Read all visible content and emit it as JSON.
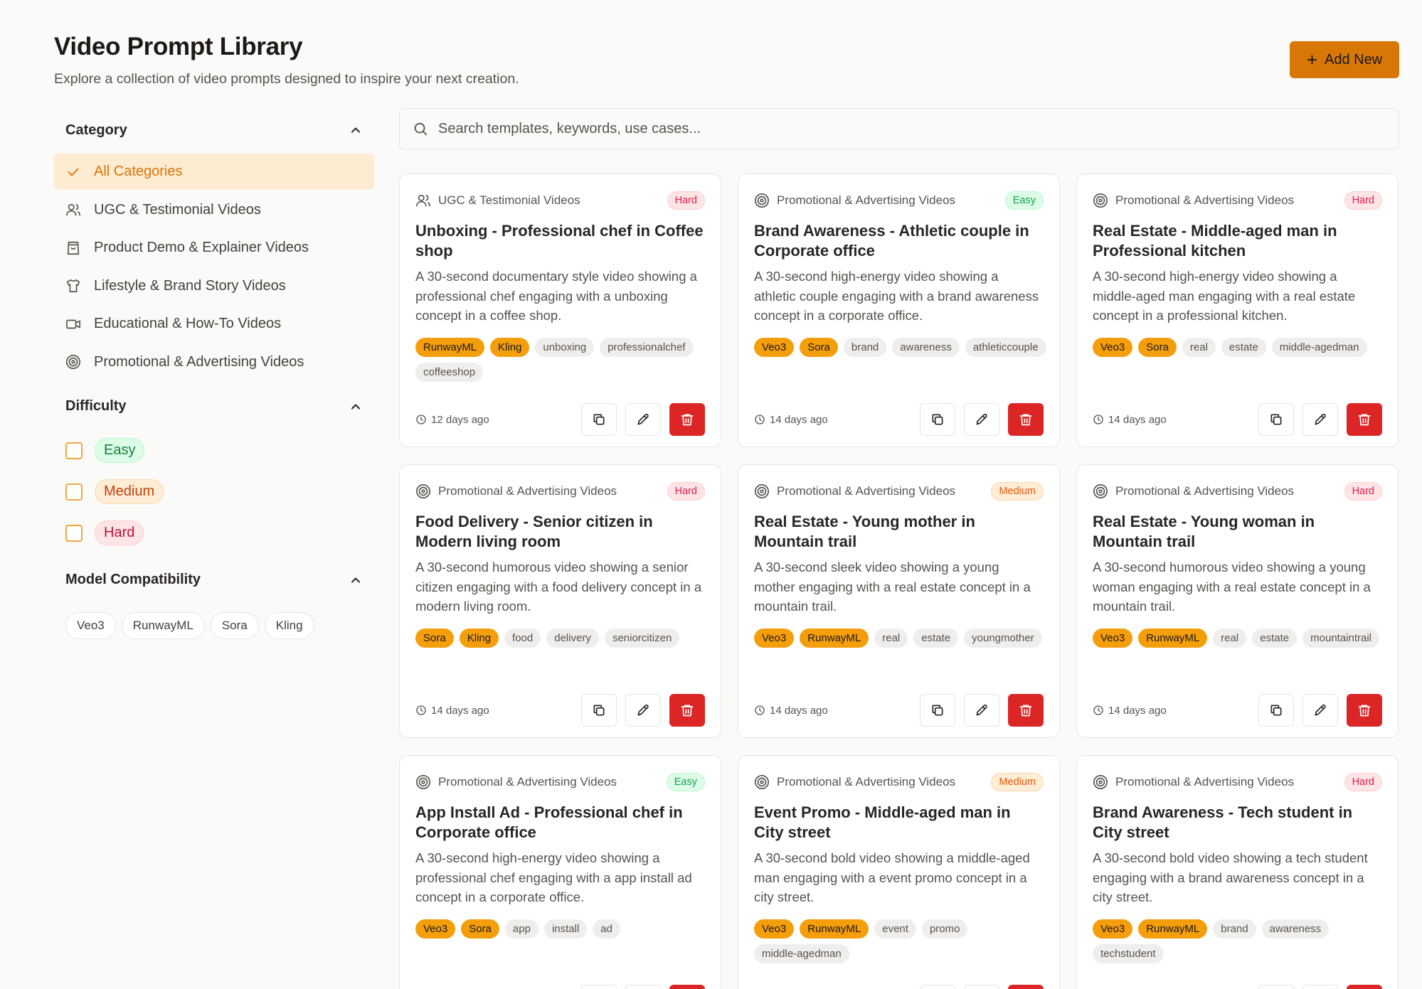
{
  "header": {
    "title": "Video Prompt Library",
    "subtitle": "Explore a collection of video prompts designed to inspire your next creation.",
    "add_label": "Add New"
  },
  "sidebar": {
    "category_title": "Category",
    "categories": [
      {
        "label": "All Categories",
        "icon": "check-icon",
        "active": true
      },
      {
        "label": "UGC & Testimonial Videos",
        "icon": "users-icon"
      },
      {
        "label": "Product Demo & Explainer Videos",
        "icon": "shopping-bag-icon"
      },
      {
        "label": "Lifestyle & Brand Story Videos",
        "icon": "shirt-icon"
      },
      {
        "label": "Educational & How-To Videos",
        "icon": "video-icon"
      },
      {
        "label": "Promotional & Advertising Videos",
        "icon": "target-icon"
      }
    ],
    "difficulty_title": "Difficulty",
    "difficulties": [
      "Easy",
      "Medium",
      "Hard"
    ],
    "model_title": "Model Compatibility",
    "models": [
      "Veo3",
      "RunwayML",
      "Sora",
      "Kling"
    ]
  },
  "search": {
    "placeholder": "Search templates, keywords, use cases..."
  },
  "cards": [
    {
      "category": "UGC & Testimonial Videos",
      "icon": "users-icon",
      "difficulty": "Hard",
      "title": "Unboxing - Professional chef in Coffee shop",
      "description": "A 30-second documentary style video showing a professional chef engaging with a unboxing concept in a coffee shop.",
      "models": [
        "RunwayML",
        "Kling"
      ],
      "tags": [
        "unboxing",
        "professionalchef",
        "coffeeshop"
      ],
      "time": "12 days ago"
    },
    {
      "category": "Promotional & Advertising Videos",
      "icon": "target-icon",
      "difficulty": "Easy",
      "title": "Brand Awareness - Athletic couple in Corporate office",
      "description": "A 30-second high-energy video showing a athletic couple engaging with a brand awareness concept in a corporate office.",
      "models": [
        "Veo3",
        "Sora"
      ],
      "tags": [
        "brand",
        "awareness",
        "athleticcouple"
      ],
      "time": "14 days ago"
    },
    {
      "category": "Promotional & Advertising Videos",
      "icon": "target-icon",
      "difficulty": "Hard",
      "title": "Real Estate - Middle-aged man in Professional kitchen",
      "description": "A 30-second high-energy video showing a middle-aged man engaging with a real estate concept in a professional kitchen.",
      "models": [
        "Veo3",
        "Sora"
      ],
      "tags": [
        "real",
        "estate",
        "middle-agedman"
      ],
      "time": "14 days ago"
    },
    {
      "category": "Promotional & Advertising Videos",
      "icon": "target-icon",
      "difficulty": "Hard",
      "title": "Food Delivery - Senior citizen in Modern living room",
      "description": "A 30-second humorous video showing a senior citizen engaging with a food delivery concept in a modern living room.",
      "models": [
        "Sora",
        "Kling"
      ],
      "tags": [
        "food",
        "delivery",
        "seniorcitizen"
      ],
      "time": "14 days ago"
    },
    {
      "category": "Promotional & Advertising Videos",
      "icon": "target-icon",
      "difficulty": "Medium",
      "title": "Real Estate - Young mother in Mountain trail",
      "description": "A 30-second sleek video showing a young mother engaging with a real estate concept in a mountain trail.",
      "models": [
        "Veo3",
        "RunwayML"
      ],
      "tags": [
        "real",
        "estate",
        "youngmother"
      ],
      "time": "14 days ago"
    },
    {
      "category": "Promotional & Advertising Videos",
      "icon": "target-icon",
      "difficulty": "Hard",
      "title": "Real Estate - Young woman in Mountain trail",
      "description": "A 30-second humorous video showing a young woman engaging with a real estate concept in a mountain trail.",
      "models": [
        "Veo3",
        "RunwayML"
      ],
      "tags": [
        "real",
        "estate",
        "mountaintrail"
      ],
      "time": "14 days ago"
    },
    {
      "category": "Promotional & Advertising Videos",
      "icon": "target-icon",
      "difficulty": "Easy",
      "title": "App Install Ad - Professional chef in Corporate office",
      "description": "A 30-second high-energy video showing a professional chef engaging with a app install ad concept in a corporate office.",
      "models": [
        "Veo3",
        "Sora"
      ],
      "tags": [
        "app",
        "install",
        "ad"
      ],
      "time": ""
    },
    {
      "category": "Promotional & Advertising Videos",
      "icon": "target-icon",
      "difficulty": "Medium",
      "title": "Event Promo - Middle-aged man in City street",
      "description": "A 30-second bold video showing a middle-aged man engaging with a event promo concept in a city street.",
      "models": [
        "Veo3",
        "RunwayML"
      ],
      "tags": [
        "event",
        "promo",
        "middle-agedman"
      ],
      "time": ""
    },
    {
      "category": "Promotional & Advertising Videos",
      "icon": "target-icon",
      "difficulty": "Hard",
      "title": "Brand Awareness - Tech student in City street",
      "description": "A 30-second bold video showing a tech student engaging with a brand awareness concept in a city street.",
      "models": [
        "Veo3",
        "RunwayML"
      ],
      "tags": [
        "brand",
        "awareness",
        "techstudent"
      ],
      "time": ""
    }
  ],
  "colors": {
    "accent": "#d97706",
    "model_tag": "#f59e0b",
    "delete": "#dc2626"
  }
}
